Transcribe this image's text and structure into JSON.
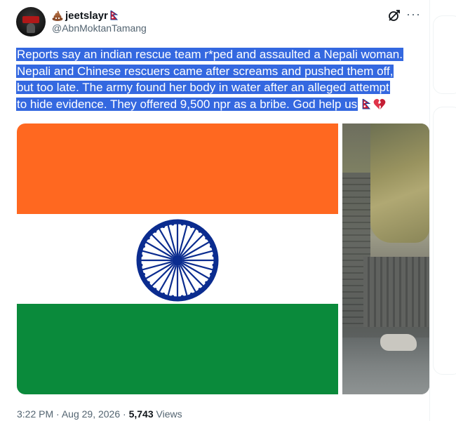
{
  "tweet": {
    "display_name": "jeetslayr",
    "handle": "@AbnMoktanTamang",
    "text_lines": [
      "Reports say an indian rescue team r*ped and assaulted a Nepali woman.",
      "Nepali and Chinese rescuers came after screams and pushed them off,",
      "but too late. The army found her body in water after an alleged attempt",
      "to hide evidence. They offered 9,500 npr as a bribe. God help us"
    ],
    "time": "3:22 PM",
    "separator": "·",
    "date": "Aug 29, 2026",
    "views_count": "5,743",
    "views_label": "Views",
    "more_label": "···"
  },
  "icons": {
    "name_emoji": "pile-of-poo-icon",
    "flag": "nepal-flag-icon",
    "heart": "broken-heart-icon",
    "grok": "grok-icon",
    "more": "more-icon"
  },
  "colors": {
    "selection_highlight": "#3468e0",
    "saffron": "#ff6820",
    "green": "#0a8a3b",
    "chakra_blue": "#0b2c8f",
    "secondary_text": "#536471"
  }
}
